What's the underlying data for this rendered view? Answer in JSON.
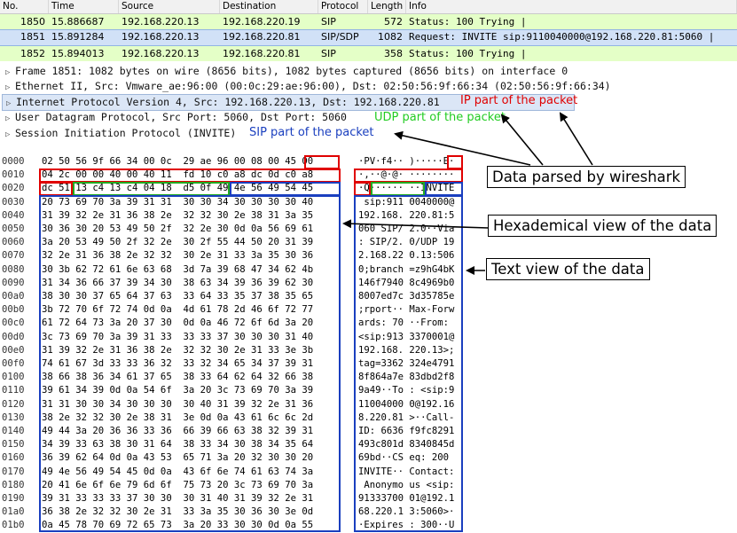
{
  "packet_list": {
    "columns": [
      "No.",
      "Time",
      "Source",
      "Destination",
      "Protocol",
      "Length",
      "Info"
    ],
    "rows": [
      {
        "no": "1850",
        "time": "15.886687",
        "src": "192.168.220.13",
        "dst": "192.168.220.19",
        "proto": "SIP",
        "len": "572",
        "info": "Status: 100 Trying |"
      },
      {
        "no": "1851",
        "time": "15.891284",
        "src": "192.168.220.13",
        "dst": "192.168.220.81",
        "proto": "SIP/SDP",
        "len": "1082",
        "info": "Request: INVITE sip:9110040000@192.168.220.81:5060 |"
      },
      {
        "no": "1852",
        "time": "15.894013",
        "src": "192.168.220.13",
        "dst": "192.168.220.81",
        "proto": "SIP",
        "len": "358",
        "info": "Status: 100 Trying |"
      }
    ]
  },
  "tree": [
    "Frame 1851: 1082 bytes on wire (8656 bits), 1082 bytes captured (8656 bits) on interface 0",
    "Ethernet II, Src: Vmware_ae:96:00 (00:0c:29:ae:96:00), Dst: 02:50:56:9f:66:34 (02:50:56:9f:66:34)",
    "Internet Protocol Version 4, Src: 192.168.220.13, Dst: 192.168.220.81",
    "User Datagram Protocol, Src Port: 5060, Dst Port: 5060",
    "Session Initiation Protocol (INVITE)"
  ],
  "annotations": {
    "ip": "IP part of the packet",
    "udp": "UDP part of the packet",
    "sip": "SIP part of the packet",
    "parsed": "Data parsed by wireshark",
    "hex": "Hexademical view of the data",
    "text": "Text view of the data"
  },
  "colors": {
    "ip": "#e00000",
    "udp": "#22aa22",
    "sip": "#1a3fbf"
  },
  "hex_rows": [
    {
      "off": "0000",
      "hex": "02 50 56 9f 66 34 00 0c  29 ae 96 00 08 00 45 00",
      "asc": "·PV·f4·· )·····E·"
    },
    {
      "off": "0010",
      "hex": "04 2c 00 00 40 00 40 11  fd 10 c0 a8 dc 0d c0 a8",
      "asc": "·,··@·@· ········"
    },
    {
      "off": "0020",
      "hex": "dc 51 13 c4 13 c4 04 18  d5 0f 49 4e 56 49 54 45",
      "asc": "·Q······ ··INVITE"
    },
    {
      "off": "0030",
      "hex": "20 73 69 70 3a 39 31 31  30 30 34 30 30 30 30 40",
      "asc": " sip:911 0040000@"
    },
    {
      "off": "0040",
      "hex": "31 39 32 2e 31 36 38 2e  32 32 30 2e 38 31 3a 35",
      "asc": "192.168. 220.81:5"
    },
    {
      "off": "0050",
      "hex": "30 36 30 20 53 49 50 2f  32 2e 30 0d 0a 56 69 61",
      "asc": "060 SIP/ 2.0··Via"
    },
    {
      "off": "0060",
      "hex": "3a 20 53 49 50 2f 32 2e  30 2f 55 44 50 20 31 39",
      "asc": ": SIP/2. 0/UDP 19"
    },
    {
      "off": "0070",
      "hex": "32 2e 31 36 38 2e 32 32  30 2e 31 33 3a 35 30 36",
      "asc": "2.168.22 0.13:506"
    },
    {
      "off": "0080",
      "hex": "30 3b 62 72 61 6e 63 68  3d 7a 39 68 47 34 62 4b",
      "asc": "0;branch =z9hG4bK"
    },
    {
      "off": "0090",
      "hex": "31 34 36 66 37 39 34 30  38 63 34 39 36 39 62 30",
      "asc": "146f7940 8c4969b0"
    },
    {
      "off": "00a0",
      "hex": "38 30 30 37 65 64 37 63  33 64 33 35 37 38 35 65",
      "asc": "8007ed7c 3d35785e"
    },
    {
      "off": "00b0",
      "hex": "3b 72 70 6f 72 74 0d 0a  4d 61 78 2d 46 6f 72 77",
      "asc": ";rport·· Max-Forw"
    },
    {
      "off": "00c0",
      "hex": "61 72 64 73 3a 20 37 30  0d 0a 46 72 6f 6d 3a 20",
      "asc": "ards: 70 ··From: "
    },
    {
      "off": "00d0",
      "hex": "3c 73 69 70 3a 39 31 33  33 33 37 30 30 30 31 40",
      "asc": "<sip:913 3370001@"
    },
    {
      "off": "00e0",
      "hex": "31 39 32 2e 31 36 38 2e  32 32 30 2e 31 33 3e 3b",
      "asc": "192.168. 220.13>;"
    },
    {
      "off": "00f0",
      "hex": "74 61 67 3d 33 33 36 32  33 32 34 65 34 37 39 31",
      "asc": "tag=3362 324e4791"
    },
    {
      "off": "0100",
      "hex": "38 66 38 36 34 61 37 65  38 33 64 62 64 32 66 38",
      "asc": "8f864a7e 83dbd2f8"
    },
    {
      "off": "0110",
      "hex": "39 61 34 39 0d 0a 54 6f  3a 20 3c 73 69 70 3a 39",
      "asc": "9a49··To : <sip:9"
    },
    {
      "off": "0120",
      "hex": "31 31 30 30 34 30 30 30  30 40 31 39 32 2e 31 36",
      "asc": "11004000 0@192.16"
    },
    {
      "off": "0130",
      "hex": "38 2e 32 32 30 2e 38 31  3e 0d 0a 43 61 6c 6c 2d",
      "asc": "8.220.81 >··Call-"
    },
    {
      "off": "0140",
      "hex": "49 44 3a 20 36 36 33 36  66 39 66 63 38 32 39 31",
      "asc": "ID: 6636 f9fc8291"
    },
    {
      "off": "0150",
      "hex": "34 39 33 63 38 30 31 64  38 33 34 30 38 34 35 64",
      "asc": "493c801d 8340845d"
    },
    {
      "off": "0160",
      "hex": "36 39 62 64 0d 0a 43 53  65 71 3a 20 32 30 30 20",
      "asc": "69bd··CS eq: 200 "
    },
    {
      "off": "0170",
      "hex": "49 4e 56 49 54 45 0d 0a  43 6f 6e 74 61 63 74 3a",
      "asc": "INVITE·· Contact:"
    },
    {
      "off": "0180",
      "hex": "20 41 6e 6f 6e 79 6d 6f  75 73 20 3c 73 69 70 3a",
      "asc": " Anonymo us <sip:"
    },
    {
      "off": "0190",
      "hex": "39 31 33 33 33 37 30 30  30 31 40 31 39 32 2e 31",
      "asc": "91333700 01@192.1"
    },
    {
      "off": "01a0",
      "hex": "36 38 2e 32 32 30 2e 31  33 3a 35 30 36 30 3e 0d",
      "asc": "68.220.1 3:5060>·"
    },
    {
      "off": "01b0",
      "hex": "0a 45 78 70 69 72 65 73  3a 20 33 30 30 0d 0a 55",
      "asc": "·Expires : 300··U"
    }
  ]
}
